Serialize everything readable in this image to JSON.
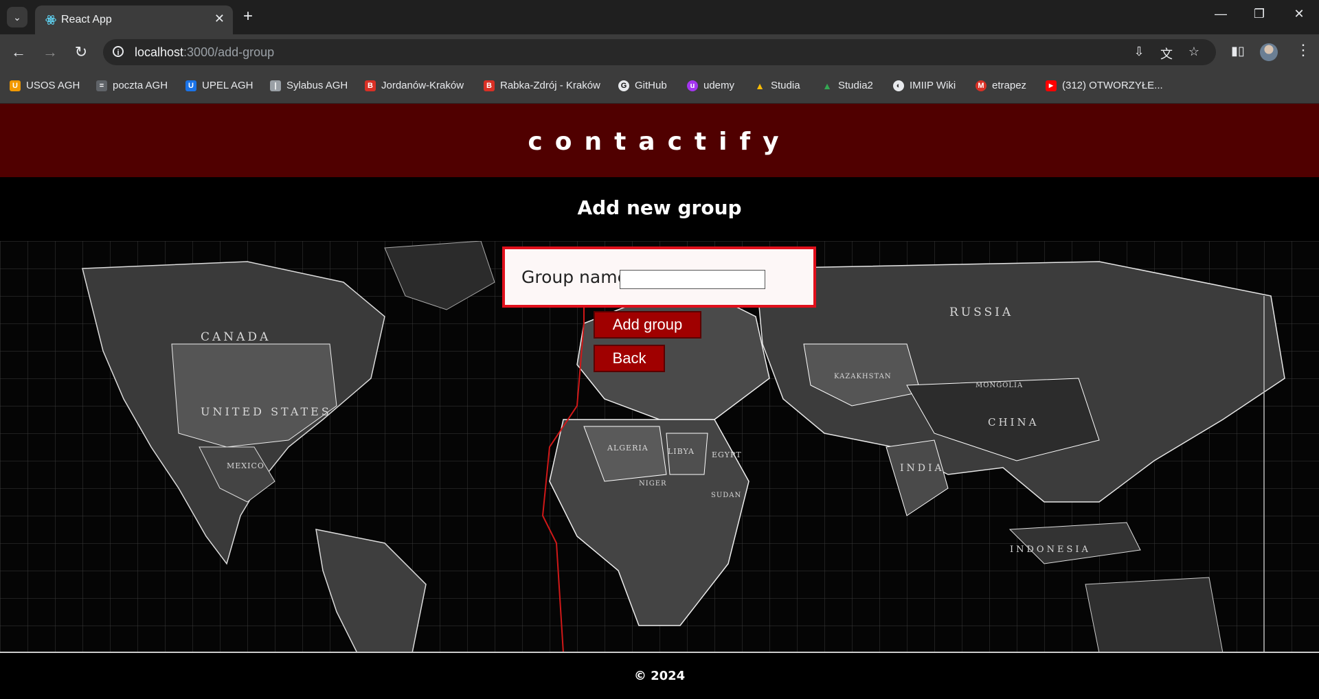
{
  "browser": {
    "tab_title": "React App",
    "url_host": "localhost",
    "url_path": ":3000/add-group",
    "bookmarks": [
      {
        "label": "USOS AGH",
        "color": "#f29900",
        "glyph": "U"
      },
      {
        "label": "poczta AGH",
        "color": "#5f6368",
        "glyph": "="
      },
      {
        "label": "UPEL AGH",
        "color": "#1a73e8",
        "glyph": "U"
      },
      {
        "label": "Sylabus AGH",
        "color": "#9aa0a6",
        "glyph": "|"
      },
      {
        "label": "Jordanów-Kraków",
        "color": "#d93025",
        "glyph": "B"
      },
      {
        "label": "Rabka-Zdrój - Kraków",
        "color": "#d93025",
        "glyph": "B"
      },
      {
        "label": "GitHub",
        "color": "#e8eaed",
        "glyph": "G"
      },
      {
        "label": "udemy",
        "color": "#a435f0",
        "glyph": "u"
      },
      {
        "label": "Studia",
        "color": "#fbbc04",
        "glyph": "▲"
      },
      {
        "label": "Studia2",
        "color": "#34a853",
        "glyph": "▲"
      },
      {
        "label": "IMIIP Wiki",
        "color": "#e8eaed",
        "glyph": "◐"
      },
      {
        "label": "etrapez",
        "color": "#d93025",
        "glyph": "M"
      },
      {
        "label": "(312) OTWORZYŁE...",
        "color": "#ff0000",
        "glyph": "▶"
      }
    ]
  },
  "app": {
    "brand": "contactify",
    "page_title": "Add new group",
    "form": {
      "group_name_label": "Group name:",
      "group_name_value": ""
    },
    "buttons": {
      "add_group": "Add group",
      "back": "Back"
    },
    "footer": "© 2024",
    "map_labels": [
      "CANADA",
      "UNITED STATES",
      "RUSSIA",
      "CHINA",
      "INDIA",
      "ALGERIA",
      "LIBYA",
      "EGYPT",
      "MEXICO",
      "INDONESIA",
      "KAZAKHSTAN",
      "MONGOLIA",
      "NIGER",
      "SUDAN"
    ]
  }
}
